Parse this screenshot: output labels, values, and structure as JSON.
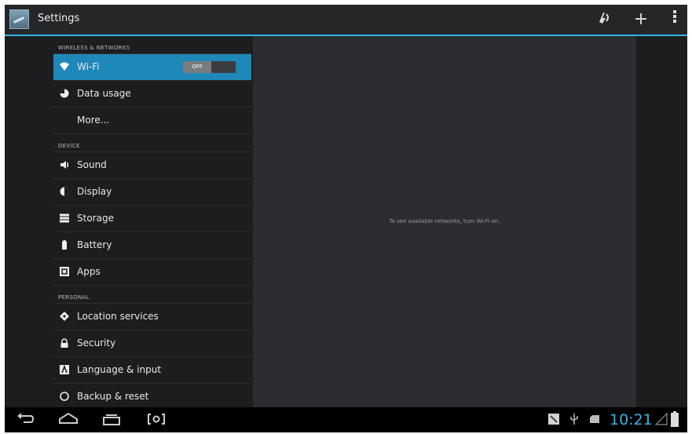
{
  "actionbar": {
    "title": "Settings",
    "icons": [
      "wireless-icon",
      "add-icon",
      "overflow-icon"
    ]
  },
  "sections": {
    "wireless": "WIRELESS & NETWORKS",
    "device": "DEVICE",
    "personal": "PERSONAL"
  },
  "items": {
    "wifi": "Wi-Fi",
    "wifi_toggle": "OFF",
    "data_usage": "Data usage",
    "more": "More...",
    "sound": "Sound",
    "display": "Display",
    "storage": "Storage",
    "battery": "Battery",
    "apps": "Apps",
    "location": "Location services",
    "security": "Security",
    "language": "Language & input",
    "backup": "Backup & reset"
  },
  "main": {
    "message": "To see available networks, turn Wi-Fi on."
  },
  "statusbar": {
    "time": "10:21"
  },
  "colors": {
    "accent": "#33b5e5",
    "active_row": "#1e88b8"
  }
}
